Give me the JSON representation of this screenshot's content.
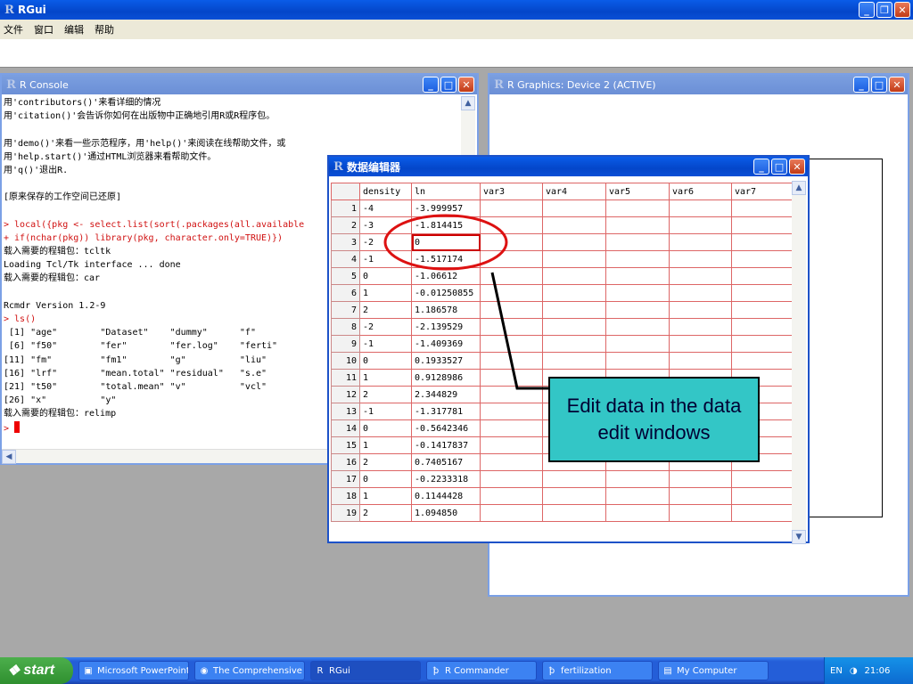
{
  "app": {
    "title": "RGui",
    "menu": [
      "文件",
      "窗口",
      "编辑",
      "帮助"
    ]
  },
  "console": {
    "title": "R Console",
    "lines": [
      {
        "text": "用'contributors()'来看详细的情况",
        "color": "black"
      },
      {
        "text": "用'citation()'会告诉你如何在出版物中正确地引用R或R程序包。",
        "color": "black"
      },
      {
        "text": "",
        "color": "black"
      },
      {
        "text": "用'demo()'来看一些示范程序，用'help()'来阅读在线帮助文件，或",
        "color": "black"
      },
      {
        "text": "用'help.start()'通过HTML浏览器来看帮助文件。",
        "color": "black"
      },
      {
        "text": "用'q()'退出R.",
        "color": "black"
      },
      {
        "text": "",
        "color": "black"
      },
      {
        "text": "[原来保存的工作空间已还原]",
        "color": "black"
      },
      {
        "text": "",
        "color": "black"
      },
      {
        "text": "> local({pkg <- select.list(sort(.packages(all.available",
        "color": "red"
      },
      {
        "text": "+ if(nchar(pkg)) library(pkg, character.only=TRUE)})",
        "color": "red"
      },
      {
        "text": "载入需要的程辑包：tcltk",
        "color": "black"
      },
      {
        "text": "Loading Tcl/Tk interface ... done",
        "color": "black"
      },
      {
        "text": "载入需要的程辑包：car",
        "color": "black"
      },
      {
        "text": "",
        "color": "black"
      },
      {
        "text": "Rcmdr Version 1.2-9",
        "color": "black"
      },
      {
        "text": "> ls()",
        "color": "red"
      },
      {
        "text": " [1] \"age\"        \"Dataset\"    \"dummy\"      \"f\"",
        "color": "black"
      },
      {
        "text": " [6] \"f50\"        \"fer\"        \"fer.log\"    \"ferti\"",
        "color": "black"
      },
      {
        "text": "[11] \"fm\"         \"fm1\"        \"g\"          \"liu\"",
        "color": "black"
      },
      {
        "text": "[16] \"lrf\"        \"mean.total\" \"residual\"   \"s.e\"",
        "color": "black"
      },
      {
        "text": "[21] \"t50\"        \"total.mean\" \"v\"          \"vcl\"",
        "color": "black"
      },
      {
        "text": "[26] \"x\"          \"y\"",
        "color": "black"
      },
      {
        "text": "载入需要的程辑包：relimp",
        "color": "black"
      }
    ],
    "prompt": ">"
  },
  "graphics": {
    "title": "R Graphics: Device 2 (ACTIVE)"
  },
  "editor": {
    "title": "数据编辑器",
    "columns": [
      "density",
      "ln",
      "var3",
      "var4",
      "var5",
      "var6",
      "var7"
    ],
    "rows": [
      {
        "n": "1",
        "density": "-4",
        "ln": "-3.999957"
      },
      {
        "n": "2",
        "density": "-3",
        "ln": "-1.814415"
      },
      {
        "n": "3",
        "density": "-2",
        "ln": "0"
      },
      {
        "n": "4",
        "density": "-1",
        "ln": "-1.517174"
      },
      {
        "n": "5",
        "density": "0",
        "ln": "-1.06612"
      },
      {
        "n": "6",
        "density": "1",
        "ln": "-0.01250855"
      },
      {
        "n": "7",
        "density": "2",
        "ln": "1.186578"
      },
      {
        "n": "8",
        "density": "-2",
        "ln": "-2.139529"
      },
      {
        "n": "9",
        "density": "-1",
        "ln": "-1.409369"
      },
      {
        "n": "10",
        "density": "0",
        "ln": "0.1933527"
      },
      {
        "n": "11",
        "density": "1",
        "ln": "0.9128986"
      },
      {
        "n": "12",
        "density": "2",
        "ln": "2.344829"
      },
      {
        "n": "13",
        "density": "-1",
        "ln": "-1.317781"
      },
      {
        "n": "14",
        "density": "0",
        "ln": "-0.5642346"
      },
      {
        "n": "15",
        "density": "1",
        "ln": "-0.1417837"
      },
      {
        "n": "16",
        "density": "2",
        "ln": "0.7405167"
      },
      {
        "n": "17",
        "density": "0",
        "ln": "-0.2233318"
      },
      {
        "n": "18",
        "density": "1",
        "ln": "0.1144428"
      },
      {
        "n": "19",
        "density": "2",
        "ln": "1.094850"
      }
    ],
    "active_cell": {
      "row": "3",
      "column": "ln"
    }
  },
  "annotation": {
    "text": "Edit data in the data edit windows",
    "background": "#33c6c6",
    "circle_color": "#dd1111"
  },
  "taskbar": {
    "start": "start",
    "items": [
      {
        "label": "Microsoft PowerPoint ...",
        "icon": "powerpoint-icon"
      },
      {
        "label": "The Comprehensive ...",
        "icon": "browser-icon"
      },
      {
        "label": "RGui",
        "icon": "r-icon",
        "active": true
      },
      {
        "label": "R Commander",
        "icon": "tk-icon"
      },
      {
        "label": "fertilization",
        "icon": "tk-icon"
      },
      {
        "label": "My Computer",
        "icon": "computer-icon"
      }
    ],
    "lang": "EN",
    "clock": "21:06"
  }
}
